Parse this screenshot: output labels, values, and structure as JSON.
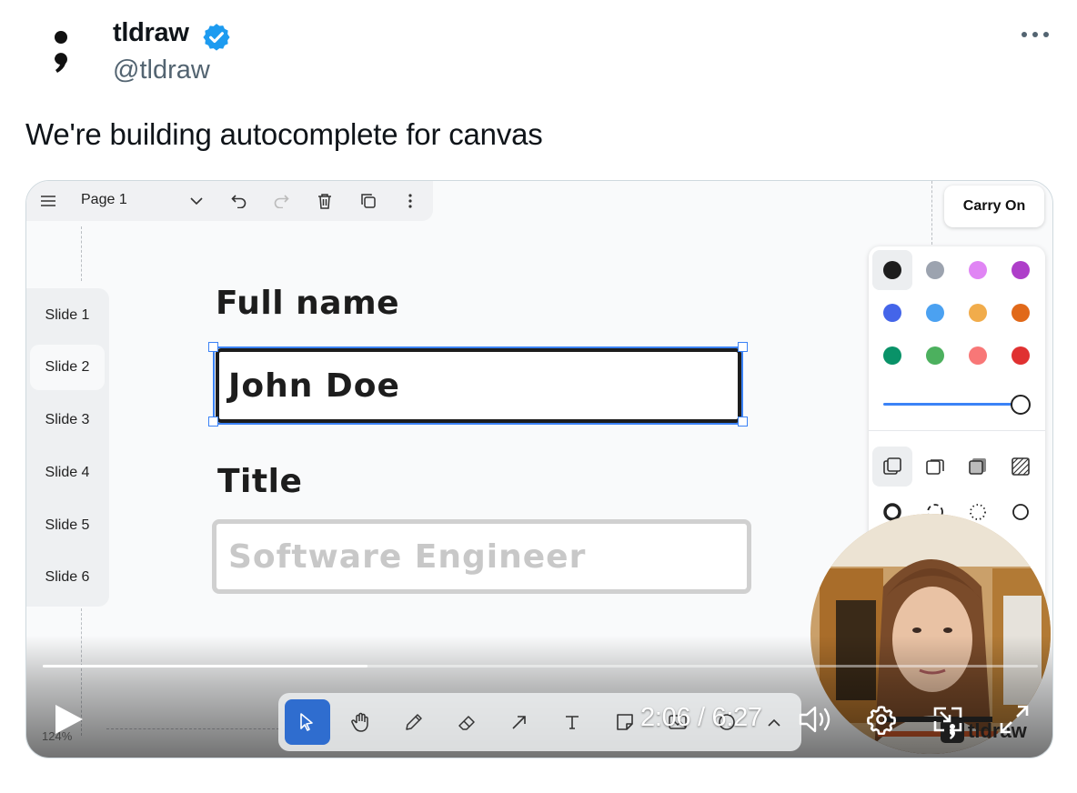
{
  "tweet": {
    "display_name": "tldraw",
    "handle": "@tldraw",
    "text": "We're building autocomplete for canvas"
  },
  "icons": {
    "avatar": "semicolon-logo",
    "verified": "verified-badge-icon",
    "more": "more-horizontal-icon"
  },
  "app": {
    "page_name": "Page 1",
    "carry_on_label": "Carry On",
    "zoom": "124%",
    "slides": [
      "Slide 1",
      "Slide 2",
      "Slide 3",
      "Slide 4",
      "Slide 5",
      "Slide 6"
    ],
    "active_slide": "Slide 2",
    "form": {
      "full_name_label": "Full name",
      "full_name_value": "John Doe",
      "title_label": "Title",
      "title_placeholder": "Software Engineer"
    },
    "colors": [
      "#1d1d1d",
      "#9ca3af",
      "#e085f4",
      "#ae3ec9",
      "#4465e9",
      "#4ba1f1",
      "#f1ac4b",
      "#e16919",
      "#099268",
      "#4cb05e",
      "#f87777",
      "#e03131"
    ],
    "accent": "#3b82f6",
    "watermark": "tldraw"
  },
  "video": {
    "current_time": "2:06",
    "duration": "6:27",
    "time_text": "2:06 / 6:27",
    "progress": 0.326
  }
}
